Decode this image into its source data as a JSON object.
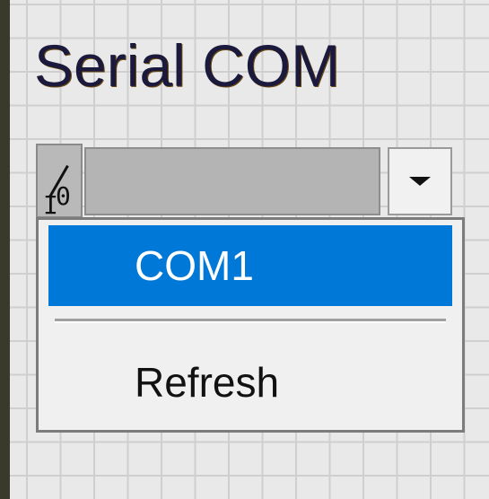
{
  "control": {
    "label": "Serial COM",
    "io_glyph_top": "I",
    "io_glyph_bottom": "0",
    "current_value": ""
  },
  "dropdown": {
    "items": [
      {
        "label": "COM1",
        "selected": true
      },
      {
        "label": "Refresh",
        "selected": false
      }
    ]
  },
  "colors": {
    "selection": "#0078d7",
    "label_text": "#1b1a3d",
    "canvas_bg": "#e9e9e9",
    "grid": "#cfcfcf"
  },
  "icons": {
    "io": "io-glyph-icon",
    "dropdown_arrow": "triangle-down-icon"
  }
}
